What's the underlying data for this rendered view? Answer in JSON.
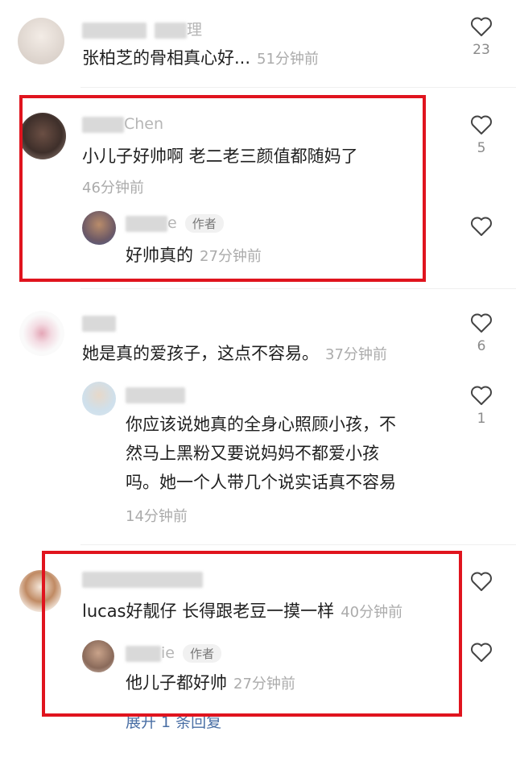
{
  "comments": [
    {
      "username": "理",
      "text": "张柏芝的骨相真心好...",
      "time": "51分钟前",
      "likes": "23"
    },
    {
      "username": "Chen",
      "text": "小儿子好帅啊 老二老三颜值都随妈了",
      "time": "46分钟前",
      "likes": "5",
      "reply": {
        "username": "e",
        "badge": "作者",
        "text": "好帅真的",
        "time": "27分钟前"
      }
    },
    {
      "username": "",
      "text": "她是真的爱孩子，这点不容易。",
      "time": "37分钟前",
      "likes": "6",
      "reply": {
        "username": "",
        "text_lines": [
          "你应该说她真的全身心照顾小孩，不",
          "然马上黑粉又要说妈妈不都爱小孩",
          "吗。她一个人带几个说实话真不容易"
        ],
        "time": "14分钟前",
        "likes": "1"
      }
    },
    {
      "username": "",
      "text": "lucas好靓仔 长得跟老豆一摸一样",
      "time": "40分钟前",
      "likes": "",
      "reply": {
        "username": "ie",
        "badge": "作者",
        "text": "他儿子都好帅",
        "time": "27分钟前"
      },
      "expand_label": "展开 1 条回复"
    }
  ],
  "colors": {
    "highlight_box": "#e0141e",
    "link": "#4a6fa5"
  },
  "icons": {
    "like": "heart-outline-icon"
  }
}
